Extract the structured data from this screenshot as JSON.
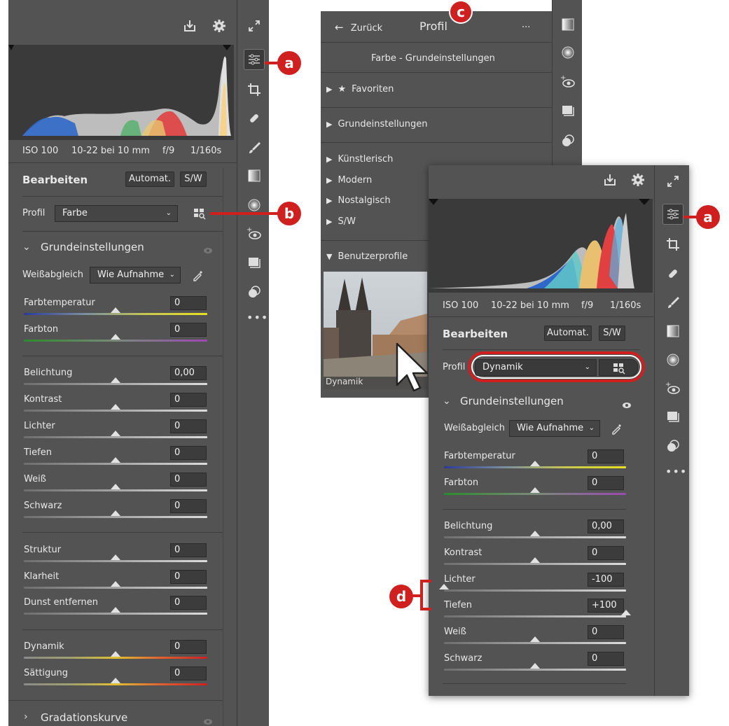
{
  "left_panel": {
    "exif": {
      "iso": "ISO 100",
      "lens": "10-22 bei 10 mm",
      "aperture": "f/9",
      "shutter": "1/160s"
    },
    "edit": {
      "title": "Bearbeiten",
      "auto": "Automat.",
      "bw": "S/W"
    },
    "profile": {
      "label": "Profil",
      "value": "Farbe"
    },
    "section": {
      "title": "Grundeinstellungen"
    },
    "white_balance": {
      "label": "Weißabgleich",
      "value": "Wie Aufnahme"
    },
    "sliders": [
      {
        "label": "Farbtemperatur",
        "value": "0"
      },
      {
        "label": "Farbton",
        "value": "0"
      },
      {
        "label": "Belichtung",
        "value": "0,00"
      },
      {
        "label": "Kontrast",
        "value": "0"
      },
      {
        "label": "Lichter",
        "value": "0"
      },
      {
        "label": "Tiefen",
        "value": "0"
      },
      {
        "label": "Weiß",
        "value": "0"
      },
      {
        "label": "Schwarz",
        "value": "0"
      },
      {
        "label": "Struktur",
        "value": "0"
      },
      {
        "label": "Klarheit",
        "value": "0"
      },
      {
        "label": "Dunst entfernen",
        "value": "0"
      },
      {
        "label": "Dynamik",
        "value": "0"
      },
      {
        "label": "Sättigung",
        "value": "0"
      }
    ],
    "next_section": {
      "title": "Gradationskurve"
    }
  },
  "profile_browser": {
    "back": "Zurück",
    "title": "Profil",
    "more": "...",
    "group_title": "Farbe - Grundeinstellungen",
    "categories": [
      {
        "label": "Favoriten"
      },
      {
        "label": "Grundeinstellungen"
      },
      {
        "label": "Künstlerisch"
      },
      {
        "label": "Modern"
      },
      {
        "label": "Nostalgisch"
      },
      {
        "label": "S/W"
      },
      {
        "label": "Benutzerprofile"
      }
    ],
    "thumbnail_caption": "Dynamik"
  },
  "right_panel": {
    "exif": {
      "iso": "ISO 100",
      "lens": "10-22 bei 10 mm",
      "aperture": "f/9",
      "shutter": "1/160s"
    },
    "edit": {
      "title": "Bearbeiten",
      "auto": "Automat.",
      "bw": "S/W"
    },
    "profile": {
      "label": "Profil",
      "value": "Dynamik"
    },
    "section": {
      "title": "Grundeinstellungen"
    },
    "white_balance": {
      "label": "Weißabgleich",
      "value": "Wie Aufnahme"
    },
    "sliders": [
      {
        "label": "Farbtemperatur",
        "value": "0"
      },
      {
        "label": "Farbton",
        "value": "0"
      },
      {
        "label": "Belichtung",
        "value": "0,00"
      },
      {
        "label": "Kontrast",
        "value": "0"
      },
      {
        "label": "Lichter",
        "value": "-100"
      },
      {
        "label": "Tiefen",
        "value": "+100"
      },
      {
        "label": "Weiß",
        "value": "0"
      },
      {
        "label": "Schwarz",
        "value": "0"
      }
    ]
  },
  "callouts": {
    "a": "a",
    "b": "b",
    "c": "c",
    "d": "d"
  },
  "colors": {
    "panel": "#535353",
    "callout": "#cf1f1f",
    "field": "#3c3c3c"
  }
}
